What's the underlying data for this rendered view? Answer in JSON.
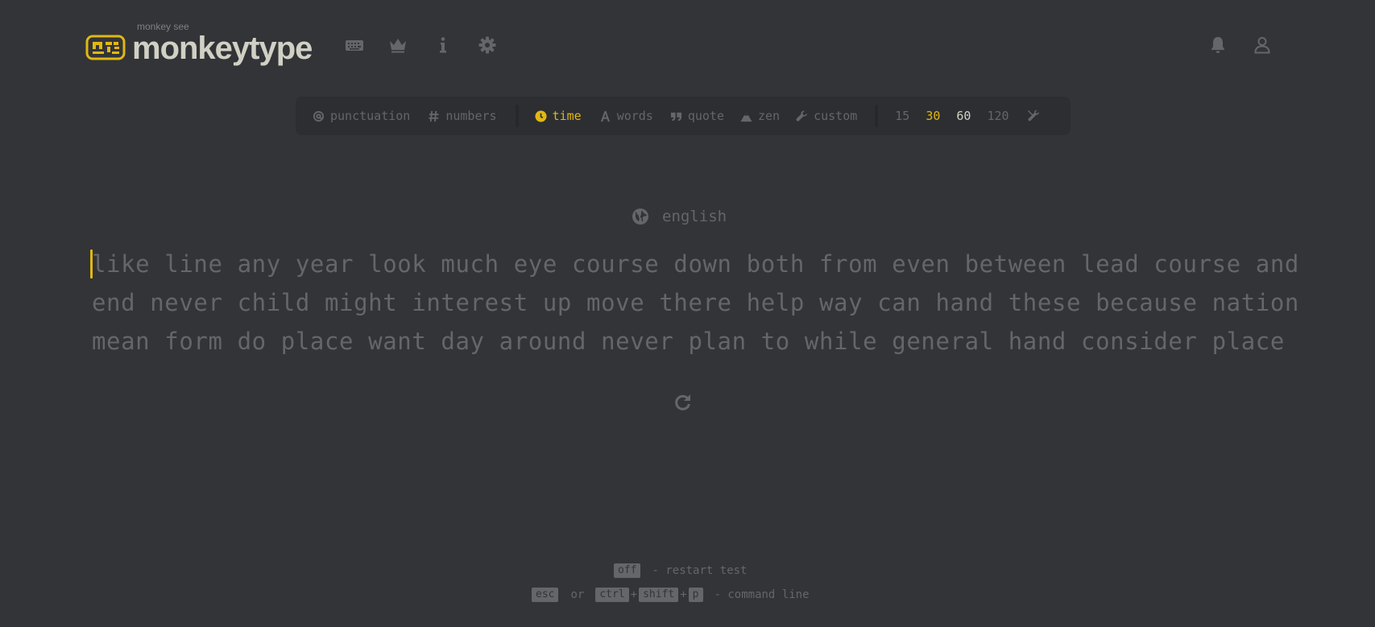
{
  "header": {
    "logo_subtitle": "monkey see",
    "logo_title": "monkeytype",
    "nav_icons": [
      "keyboard-icon",
      "crown-icon",
      "info-icon",
      "gear-icon"
    ],
    "account_icons": [
      "bell-icon",
      "user-icon"
    ]
  },
  "config": {
    "punctuation": "punctuation",
    "numbers": "numbers",
    "modes": {
      "time": "time",
      "words": "words",
      "quote": "quote",
      "zen": "zen",
      "custom": "custom"
    },
    "active_mode": "time",
    "durations": [
      "15",
      "30",
      "60",
      "120"
    ]
  },
  "test": {
    "language": "english",
    "lines": [
      "like line any year look much eye course down both from even between lead course and",
      "end never child might interest up move there help way can hand these because nation",
      "mean form do place want day around never plan to while general hand consider place"
    ]
  },
  "footer": {
    "restart": {
      "key": "off",
      "text": "- restart test"
    },
    "command": {
      "key1": "esc",
      "or": "or",
      "key2": "ctrl",
      "plus1": "+",
      "key3": "shift",
      "plus2": "+",
      "key4": "p",
      "text": "- command line"
    }
  },
  "colors": {
    "background": "#323437",
    "accent": "#e2b714",
    "text": "#d1d0c5",
    "sub": "#646669"
  }
}
